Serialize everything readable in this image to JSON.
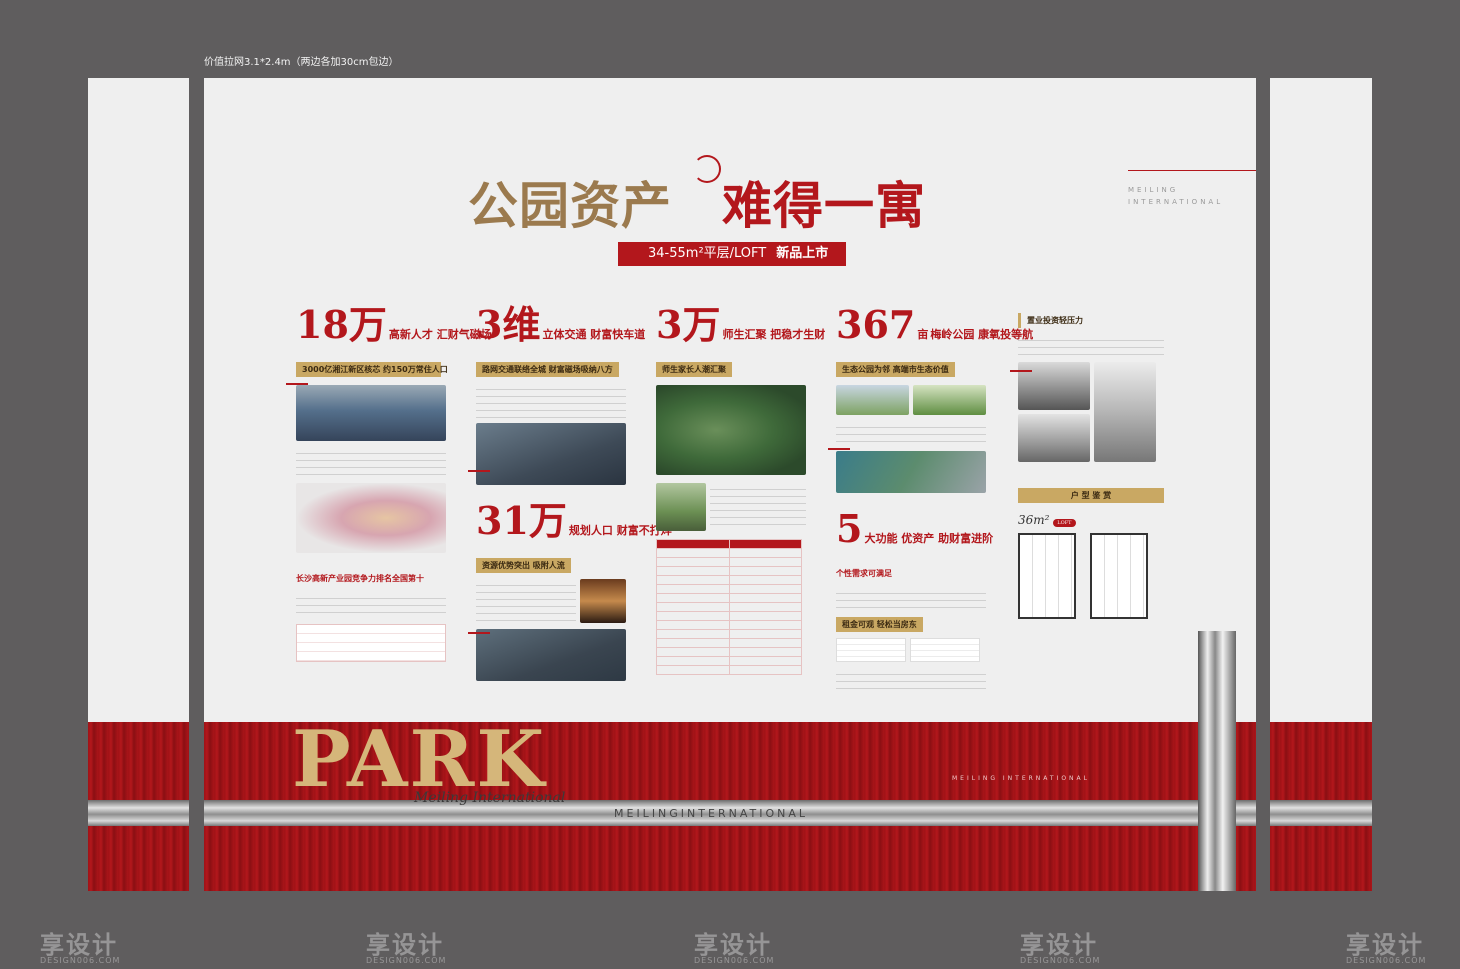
{
  "spec_text": "价值拉网3.1*2.4m（两边各加30cm包边）",
  "title_part1": "公园资产",
  "title_part2": "难得一寓",
  "subtitle_size": "34-55m²平层/LOFT",
  "subtitle_tag": "新品上市",
  "brand_lines": [
    "MEILING",
    "INTERNATIONAL"
  ],
  "watermark": "享设计",
  "watermark_sub": "DESIGN006.COM",
  "colors": {
    "red": "#b3171c",
    "gold": "#c9a863",
    "bg": "#efefef",
    "frame": "#5f5d5e"
  },
  "columns": [
    {
      "big": "18万",
      "headline": "高新人才 汇财气磁场",
      "tag": "3000亿湘江新区核芯 约150万常住人口",
      "tag2": "长沙高新产业园竞争力排名全国第十"
    },
    {
      "big": "3维",
      "headline": "立体交通 财富快车道",
      "tag": "路网交通联络全城 财富磁场吸纳八方",
      "big2": "31万",
      "headline2": "规划人口 财富不打烊",
      "tag2": "资源优势突出 吸附人流"
    },
    {
      "big": "3万",
      "headline": "师生汇聚 把稳才生财",
      "tag": "师生家长人潮汇聚"
    },
    {
      "big": "367",
      "unit": "亩",
      "headline": "梅岭公园 康氧投等航",
      "tag": "生态公园为邻 高端市生态价值",
      "big2": "5",
      "headline2": "大功能 优资产 助财富进阶",
      "tag2": "个性需求可满足",
      "tag3": "租金可观 轻松当房东"
    },
    {
      "tag": "置业投资轻压力",
      "plan_tag": "户 型 鉴 赏",
      "area": "36m²",
      "loft": "LOFT"
    }
  ],
  "park": "PARK",
  "park_sub": "Meiling International",
  "band_text_1": "MEILING INTERNATIONAL",
  "band_text_2": "MEILINGINTERNATIONAL"
}
